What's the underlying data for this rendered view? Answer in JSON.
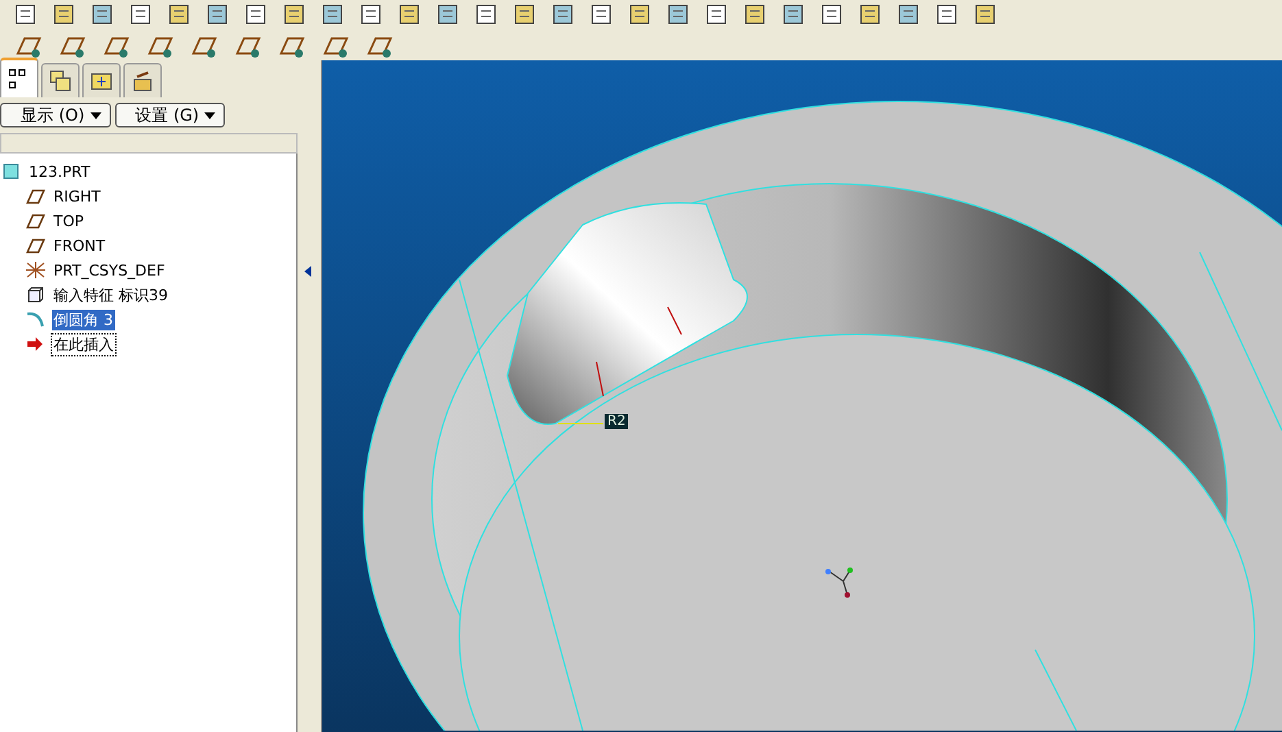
{
  "panel_tabs": [
    {
      "selected": true
    },
    {
      "selected": false
    },
    {
      "selected": false
    },
    {
      "selected": false
    }
  ],
  "panel_buttons": [
    "显示 (O)",
    "设置 (G)"
  ],
  "model_tree": {
    "label": "123.PRT",
    "kind": "part",
    "selected": false,
    "children": [
      {
        "label": "RIGHT",
        "kind": "datum-plane",
        "selected": false
      },
      {
        "label": "TOP",
        "kind": "datum-plane",
        "selected": false
      },
      {
        "label": "FRONT",
        "kind": "datum-plane",
        "selected": false
      },
      {
        "label": "PRT_CSYS_DEF",
        "kind": "csys",
        "selected": false
      },
      {
        "label": "输入特征 标识39",
        "kind": "import",
        "selected": false
      },
      {
        "label": "倒圆角 3",
        "kind": "round",
        "selected": true
      },
      {
        "label": "在此插入",
        "kind": "insert",
        "selected": false
      }
    ]
  },
  "viewport": {
    "dimension_label": "R2"
  }
}
